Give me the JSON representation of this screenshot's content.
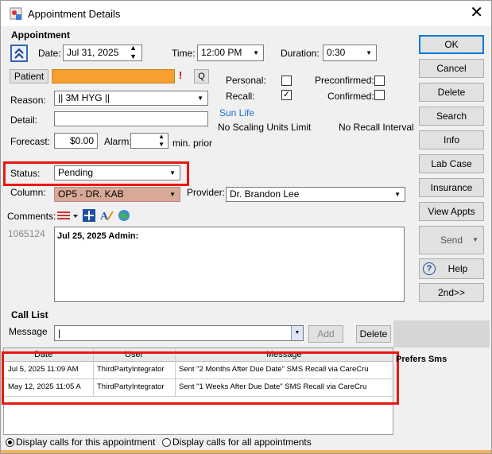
{
  "window": {
    "title": "Appointment Details",
    "close": "✕"
  },
  "appointment": {
    "section_label": "Appointment",
    "date_label": "Date:",
    "date_value": "Jul 31, 2025",
    "time_label": "Time:",
    "time_value": "12:00 PM",
    "duration_label": "Duration:",
    "duration_value": "0:30",
    "patient_button": "Patient",
    "q_button": "Q",
    "alert_mark": "!",
    "personal_label": "Personal:",
    "personal_checked": false,
    "preconfirmed_label": "Preconfirmed:",
    "preconfirmed_checked": false,
    "recall_label": "Recall:",
    "recall_checked": true,
    "confirmed_label": "Confirmed:",
    "confirmed_checked": false,
    "reason_label": "Reason:",
    "reason_value": "|| 3M HYG ||",
    "detail_label": "Detail:",
    "detail_value": "",
    "insurance_link": "Sun Life",
    "no_scaling": "No Scaling Units Limit",
    "no_recall": "No Recall Interval",
    "forecast_label": "Forecast:",
    "forecast_value": "$0.00",
    "alarm_label": "Alarm:",
    "alarm_value": "",
    "min_prior": "min. prior",
    "status_label": "Status:",
    "status_value": "Pending",
    "column_label": "Column:",
    "column_value": "OP5 - DR. KAB",
    "provider_label": "Provider:",
    "provider_value": "Dr. Brandon Lee",
    "comments_label": "Comments:",
    "record_id": "1065124",
    "comments_text": "Jul 25, 2025 Admin:"
  },
  "buttons": {
    "ok": "OK",
    "cancel": "Cancel",
    "delete": "Delete",
    "search": "Search",
    "info": "Info",
    "lab_case": "Lab Case",
    "insurance": "Insurance",
    "view_appts": "View Appts",
    "send": "Send",
    "help": "Help",
    "second": "2nd>>"
  },
  "call_list": {
    "title": "Call List",
    "message_label": "Message",
    "message_value": "|",
    "add_button": "Add",
    "delete_button": "Delete",
    "prefers_sms": "Prefers Sms",
    "columns": [
      "Date",
      "User",
      "Message"
    ],
    "rows": [
      {
        "date": "Jul 5, 2025 11:09 AM",
        "user": "ThirdPartyIntegrator",
        "message": "Sent \"2 Months After Due Date\" SMS Recall via CareCru"
      },
      {
        "date": "May 12, 2025 11:05 A",
        "user": "ThirdPartyIntegrator",
        "message": "Sent \"1 Weeks After Due Date\" SMS Recall via CareCru"
      }
    ],
    "radio_this": "Display calls for this appointment",
    "radio_all": "Display calls for all appointments",
    "radio_selected": "this"
  },
  "colors": {
    "patient_bar": "#f7a030",
    "highlight_red": "#e8190f",
    "column_bg": "#d9a998",
    "link_blue": "#1e6fd6"
  }
}
